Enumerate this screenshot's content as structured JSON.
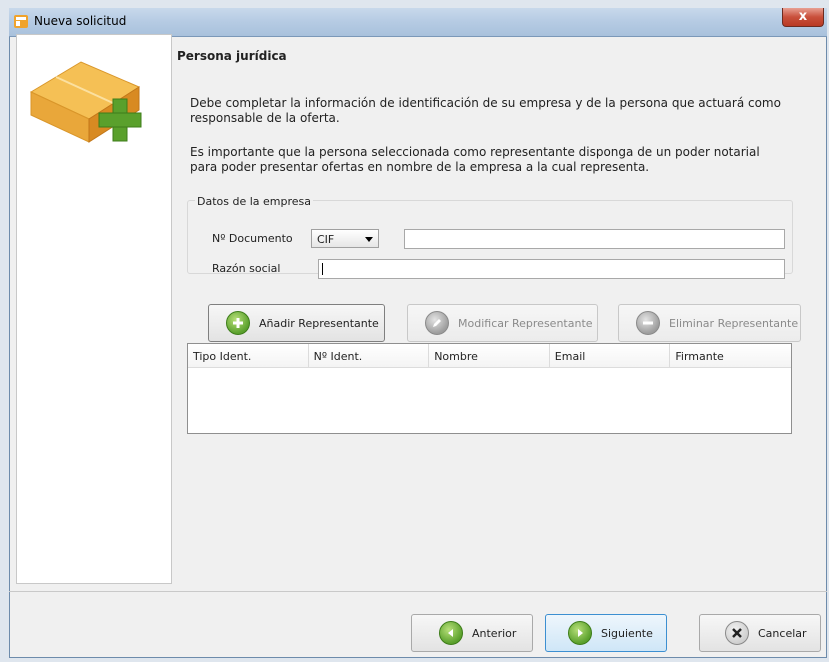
{
  "window": {
    "title": "Nueva solicitud",
    "close_glyph": "x"
  },
  "content": {
    "heading": "Persona jurídica",
    "paragraph1": "Debe completar la información de identificación de su empresa y de la persona que actuará como responsable de la oferta.",
    "paragraph2": "Es importante que la persona seleccionada como representante disponga de un poder notarial para poder presentar ofertas en nombre de la empresa a la cual representa."
  },
  "company": {
    "group_label": "Datos de la empresa",
    "doc_label": "Nº Documento",
    "doc_type_selected": "CIF",
    "doc_number_value": "",
    "name_label": "Razón social",
    "name_value": ""
  },
  "representative_buttons": {
    "add": "Añadir Representante",
    "modify": "Modificar Representante",
    "delete": "Eliminar Representante"
  },
  "table": {
    "columns": [
      "Tipo Ident.",
      "Nº Ident.",
      "Nombre",
      "Email",
      "Firmante"
    ],
    "rows": []
  },
  "footer": {
    "previous": "Anterior",
    "next": "Siguiente",
    "cancel": "Cancelar"
  },
  "icons": {
    "title": "app-icon",
    "sidebar": "package-add-icon",
    "add": "plus-icon",
    "modify": "pencil-icon",
    "delete": "minus-icon",
    "previous": "arrow-left-icon",
    "next": "arrow-right-icon",
    "cancel": "x-icon"
  },
  "colors": {
    "green": "#5aa02c",
    "blue_accent": "#3c8fd1"
  }
}
